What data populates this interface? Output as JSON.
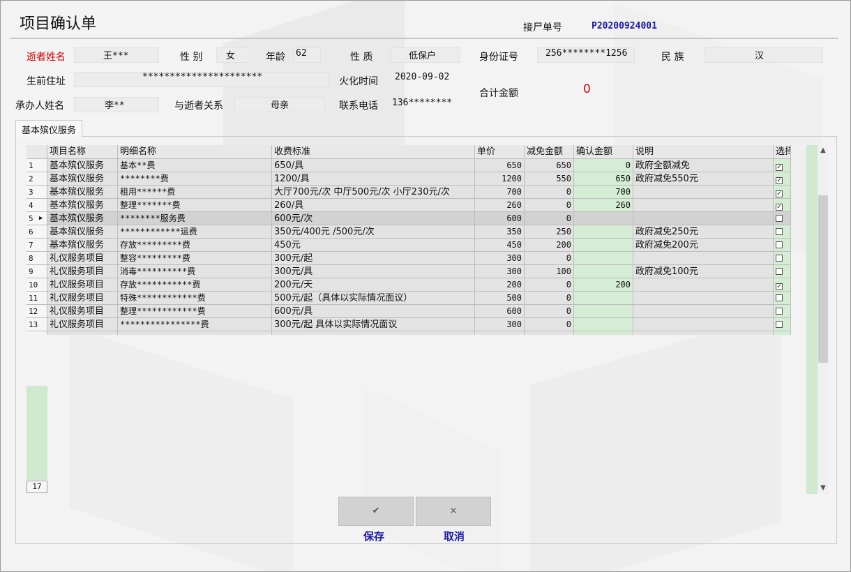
{
  "window": {
    "title": "项目确认单"
  },
  "header": {
    "receipt_label": "接尸单号",
    "receipt_no": "P20200924001"
  },
  "info": {
    "deceased_name_label": "逝者姓名",
    "deceased_name": "王***",
    "gender_label": "性 别",
    "gender": "女",
    "age_label": "年龄",
    "age": "62",
    "nature_label": "性 质",
    "nature": "低保户",
    "id_label": "身份证号",
    "id_no": "256********1256",
    "ethnic_label": "民 族",
    "ethnic": "汉",
    "address_label": "生前住址",
    "address": "**********************",
    "cremation_label": "火化时间",
    "cremation_date": "2020-09-02",
    "total_label": "合计金额",
    "total": "0",
    "agent_label": "承办人姓名",
    "agent_name": "李**",
    "relation_label": "与逝者关系",
    "relation": "母亲",
    "phone_label": "联系电话",
    "phone": "136********"
  },
  "tabs": [
    {
      "label": "基本殡仪服务"
    }
  ],
  "table": {
    "columns": [
      "项目名称",
      "明细名称",
      "收费标准",
      "单价",
      "减免金额",
      "确认金额",
      "说明",
      "选择"
    ],
    "rows": [
      {
        "idx": "1",
        "item": "基本殡仪服务",
        "detail": "基本**费",
        "standard": "650/具",
        "price": "650",
        "reduction": "650",
        "confirmed": "0",
        "note": "政府全额减免",
        "checked": true
      },
      {
        "idx": "2",
        "item": "基本殡仪服务",
        "detail": "********费",
        "standard": "1200/具",
        "price": "1200",
        "reduction": "550",
        "confirmed": "650",
        "note": "政府减免550元",
        "checked": true
      },
      {
        "idx": "3",
        "item": "基本殡仪服务",
        "detail": "租用******费",
        "standard": "大厅700元/次 中厅500元/次 小厅230元/次",
        "price": "700",
        "reduction": "0",
        "confirmed": "700",
        "note": "",
        "checked": true
      },
      {
        "idx": "4",
        "item": "基本殡仪服务",
        "detail": "整理*******费",
        "standard": "260/具",
        "price": "260",
        "reduction": "0",
        "confirmed": "260",
        "note": "",
        "checked": true
      },
      {
        "idx": "5",
        "item": "基本殡仪服务",
        "detail": "********服务费",
        "standard": "600元/次",
        "price": "600",
        "reduction": "0",
        "confirmed": "",
        "note": "",
        "checked": false,
        "current": true
      },
      {
        "idx": "6",
        "item": "基本殡仪服务",
        "detail": "************运费",
        "standard": "350元/400元 /500元/次",
        "price": "350",
        "reduction": "250",
        "confirmed": "",
        "note": "政府减免250元",
        "checked": false
      },
      {
        "idx": "7",
        "item": "基本殡仪服务",
        "detail": "存放*********费",
        "standard": "450元",
        "price": "450",
        "reduction": "200",
        "confirmed": "",
        "note": "政府减免200元",
        "checked": false
      },
      {
        "idx": "8",
        "item": "礼仪服务项目",
        "detail": "整容*********费",
        "standard": "300元/起",
        "price": "300",
        "reduction": "0",
        "confirmed": "",
        "note": "",
        "checked": false
      },
      {
        "idx": "9",
        "item": "礼仪服务项目",
        "detail": "消毒**********费",
        "standard": "300元/具",
        "price": "300",
        "reduction": "100",
        "confirmed": "",
        "note": "政府减免100元",
        "checked": false
      },
      {
        "idx": "10",
        "item": "礼仪服务项目",
        "detail": "存放***********费",
        "standard": "200元/天",
        "price": "200",
        "reduction": "0",
        "confirmed": "200",
        "note": "",
        "checked": true
      },
      {
        "idx": "11",
        "item": "礼仪服务项目",
        "detail": "特殊************费",
        "standard": "500元/起（具体以实际情况面议）",
        "price": "500",
        "reduction": "0",
        "confirmed": "",
        "note": "",
        "checked": false
      },
      {
        "idx": "12",
        "item": "礼仪服务项目",
        "detail": "整理************费",
        "standard": "600元/具",
        "price": "600",
        "reduction": "0",
        "confirmed": "",
        "note": "",
        "checked": false
      },
      {
        "idx": "13",
        "item": "礼仪服务项目",
        "detail": "****************费",
        "standard": "300元/起 具体以实际情况面议",
        "price": "300",
        "reduction": "0",
        "confirmed": "",
        "note": "",
        "checked": false
      }
    ],
    "row_count": "17"
  },
  "buttons": {
    "save_icon": "✔",
    "save_label": "保存",
    "cancel_icon": "×",
    "cancel_label": "取消"
  },
  "icons": {
    "scroll_up": "chevron-up-icon",
    "scroll_down": "chevron-down-icon",
    "current_row": "row-pointer-icon"
  },
  "colors": {
    "label_red": "#d40000",
    "link_blue": "#1a1aa6",
    "total_red": "#e00000",
    "editable_green": "#d4edd4"
  }
}
